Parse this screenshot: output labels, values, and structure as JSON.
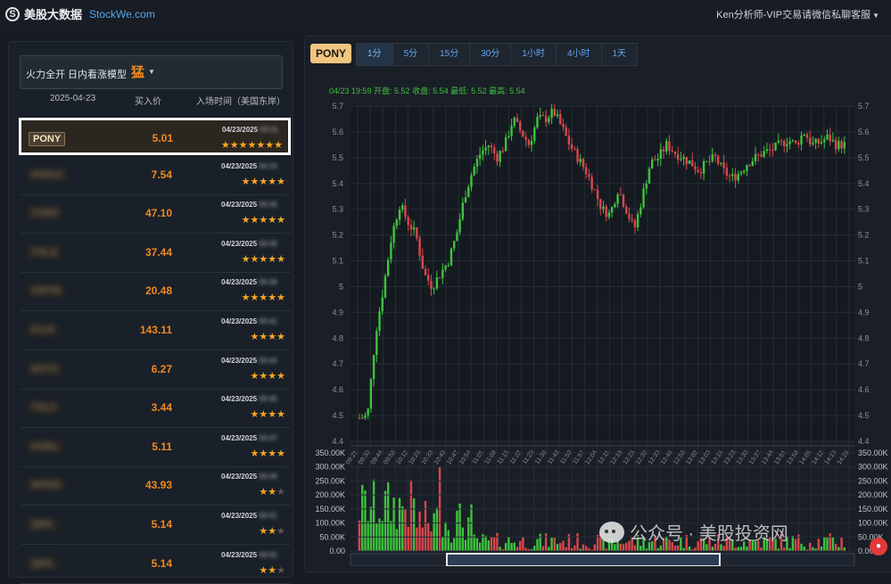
{
  "header": {
    "logo_glyph": "S",
    "brand": "美股大数据",
    "site": "StockWe.com",
    "contact": "Ken分析师-VIP交易请微信私聊客服",
    "contact_caret": "▼"
  },
  "model": {
    "label": "火力全开 日内看涨模型",
    "level": "猛",
    "caret": "▼"
  },
  "table": {
    "headers": [
      "2025-04-23",
      "买入价",
      "入场时间（美国东岸）"
    ],
    "rows": [
      {
        "ticker": "PONY",
        "price": "5.01",
        "date": "04/23/2025",
        "time": "09:31",
        "stars": 7,
        "max": 7,
        "selected": true,
        "blurred": false
      },
      {
        "ticker": "WWAX",
        "price": "7.54",
        "date": "04/23/2025",
        "time": "09:33",
        "stars": 4.5,
        "max": 5,
        "selected": false,
        "blurred": true
      },
      {
        "ticker": "TSRD",
        "price": "47.10",
        "date": "04/23/2025",
        "time": "09:35",
        "stars": 4.5,
        "max": 5,
        "selected": false,
        "blurred": true
      },
      {
        "ticker": "TSLQ",
        "price": "37.44",
        "date": "04/23/2025",
        "time": "09:36",
        "stars": 4.5,
        "max": 5,
        "selected": false,
        "blurred": true
      },
      {
        "ticker": "AMTM",
        "price": "20.48",
        "date": "04/23/2025",
        "time": "09:38",
        "stars": 4.5,
        "max": 5,
        "selected": false,
        "blurred": true
      },
      {
        "ticker": "ICLR",
        "price": "143.11",
        "date": "04/23/2025",
        "time": "09:41",
        "stars": 3.5,
        "max": 4,
        "selected": false,
        "blurred": true
      },
      {
        "ticker": "MSTZ",
        "price": "6.27",
        "date": "04/23/2025",
        "time": "09:43",
        "stars": 3.5,
        "max": 4,
        "selected": false,
        "blurred": true
      },
      {
        "ticker": "TSLZ",
        "price": "3.44",
        "date": "04/23/2025",
        "time": "09:45",
        "stars": 3.5,
        "max": 4,
        "selected": false,
        "blurred": true
      },
      {
        "ticker": "NNBL",
        "price": "5.11",
        "date": "04/23/2025",
        "time": "09:47",
        "stars": 3.5,
        "max": 4,
        "selected": false,
        "blurred": true
      },
      {
        "ticker": "WFRD",
        "price": "43.93",
        "date": "04/23/2025",
        "time": "09:49",
        "stars": 2,
        "max": 3,
        "selected": false,
        "blurred": true
      },
      {
        "ticker": "QBIL",
        "price": "5.14",
        "date": "04/23/2025",
        "time": "09:51",
        "stars": 2,
        "max": 3,
        "selected": false,
        "blurred": true
      },
      {
        "ticker": "QBIL",
        "price": "5.14",
        "date": "04/23/2025",
        "time": "09:52",
        "stars": 2,
        "max": 3,
        "selected": false,
        "blurred": true
      }
    ]
  },
  "chart_panel": {
    "symbol": "PONY",
    "tabs": [
      "1分",
      "5分",
      "15分",
      "30分",
      "1小时",
      "4小时",
      "1天"
    ],
    "active_tab": "1分",
    "info": "04/23 19:59  开盘: 5.52  收盘: 5.54  最低: 5.52  最高: 5.54"
  },
  "chart_data": {
    "type": "candlestick",
    "price_ticks": [
      "5.7",
      "5.6",
      "5.5",
      "5.4",
      "5.3",
      "5.2",
      "5.1",
      "5",
      "4.9",
      "4.8",
      "4.7",
      "4.6",
      "4.5",
      "4.4"
    ],
    "price_range": [
      4.4,
      5.7
    ],
    "volume_ticks": [
      "350.00K",
      "300.00K",
      "250.00K",
      "200.00K",
      "150.00K",
      "100.00K",
      "50.00K",
      "0.00"
    ],
    "volume_range": [
      0,
      350000
    ],
    "time_labels": [
      "09:21",
      "09:30",
      "09:44",
      "09:58",
      "10:12",
      "10:26",
      "10:33",
      "10:40",
      "10:47",
      "10:54",
      "11:01",
      "11:08",
      "11:15",
      "11:22",
      "11:29",
      "11:36",
      "11:43",
      "11:50",
      "11:57",
      "12:04",
      "12:11",
      "12:18",
      "12:25",
      "12:32",
      "12:39",
      "12:46",
      "12:53",
      "13:02",
      "13:09",
      "13:16",
      "13:23",
      "13:30",
      "13:37",
      "13:44",
      "13:51",
      "13:58",
      "14:05",
      "14:12",
      "14:19",
      "14:26"
    ],
    "close_path": [
      4.49,
      4.5,
      4.82,
      5.0,
      5.2,
      5.32,
      5.25,
      5.2,
      5.05,
      5.0,
      5.05,
      5.1,
      5.2,
      5.35,
      5.45,
      5.52,
      5.55,
      5.5,
      5.55,
      5.65,
      5.6,
      5.55,
      5.65,
      5.65,
      5.68,
      5.62,
      5.55,
      5.5,
      5.45,
      5.38,
      5.3,
      5.28,
      5.38,
      5.3,
      5.22,
      5.35,
      5.48,
      5.5,
      5.55,
      5.52,
      5.5,
      5.48,
      5.45,
      5.48,
      5.5,
      5.45,
      5.42,
      5.44,
      5.48,
      5.5,
      5.52,
      5.53,
      5.55,
      5.57,
      5.55,
      5.6,
      5.55,
      5.56,
      5.58,
      5.55,
      5.55
    ],
    "colors": {
      "up": "#3fc23f",
      "down": "#d8474b",
      "grid": "#262d37",
      "axis_text": "#8a9099"
    }
  },
  "watermark": {
    "text": "公众号 · 美股投资网"
  }
}
